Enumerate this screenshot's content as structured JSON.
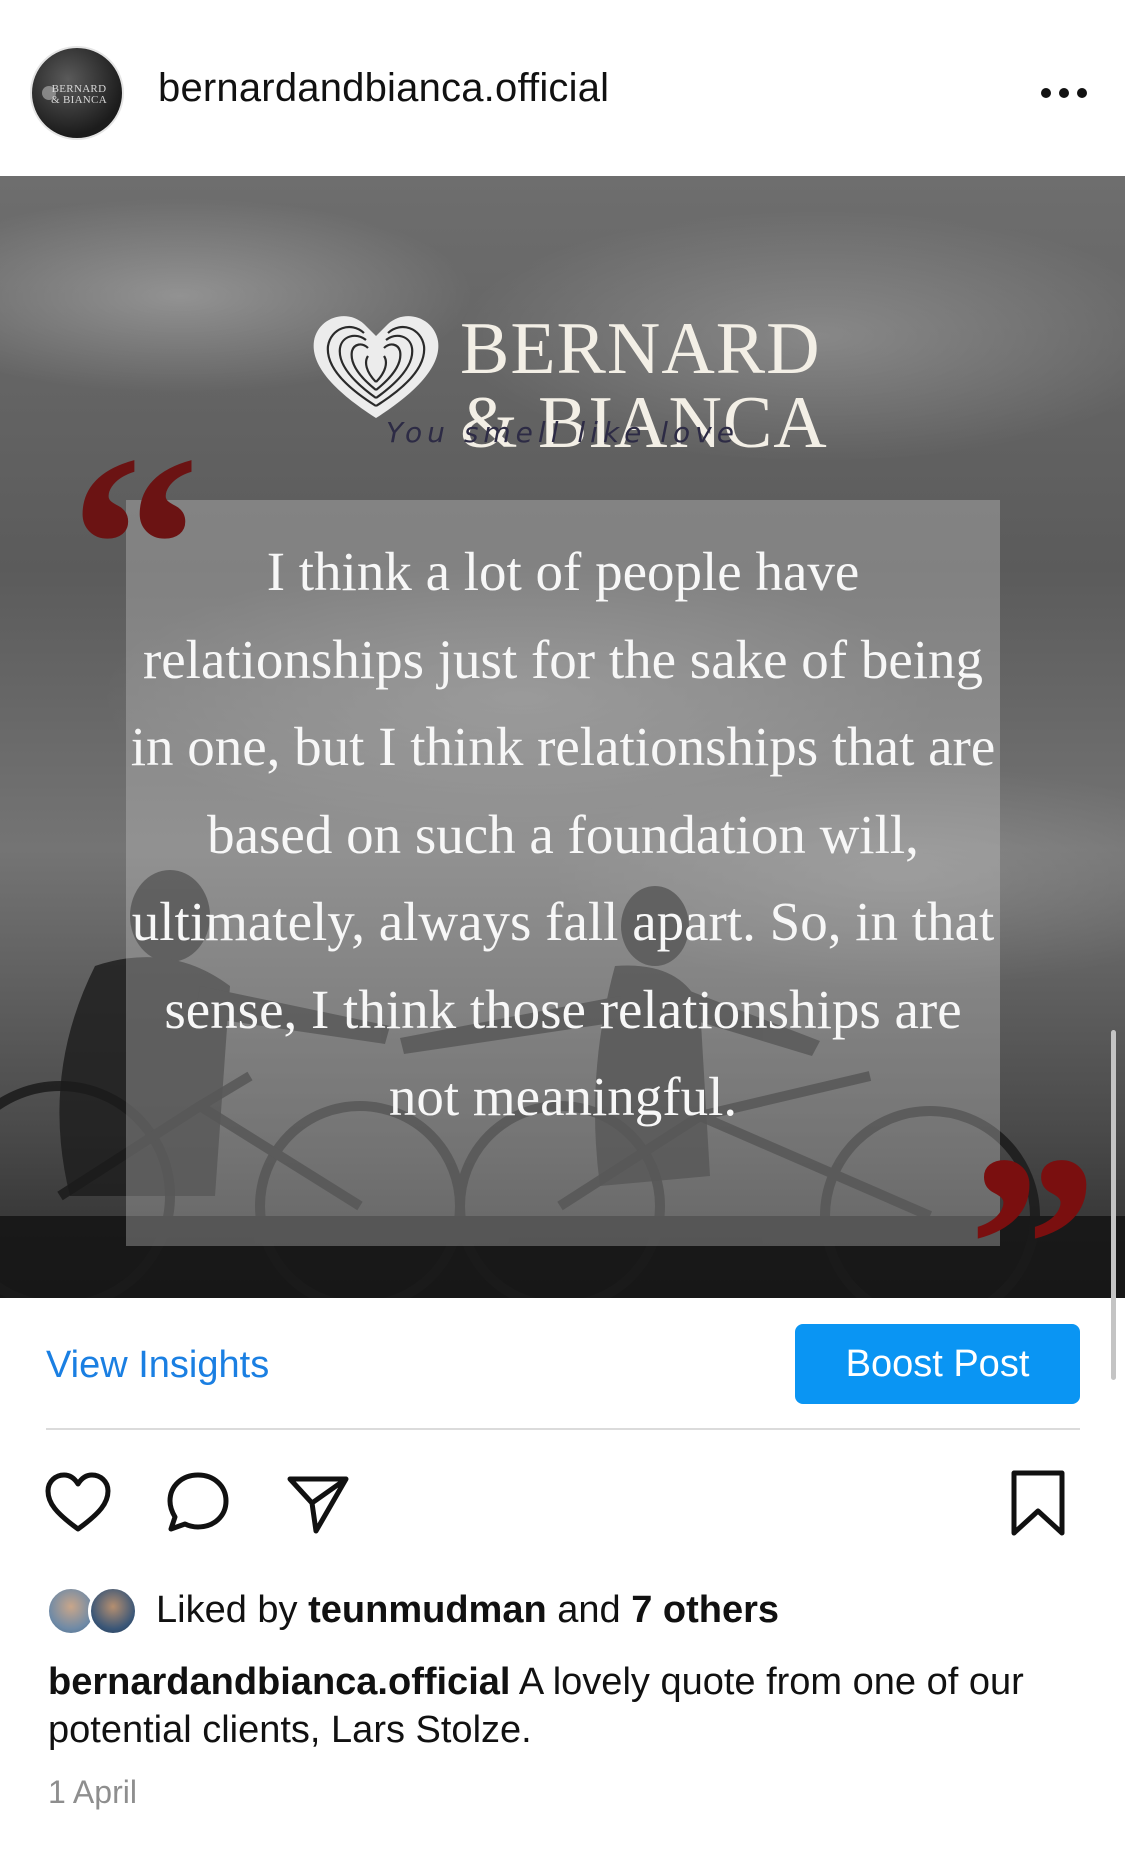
{
  "header": {
    "username": "bernardandbianca.official",
    "avatar_text": "BERNARD & BIANCA",
    "more_icon": "more-horizontal-icon"
  },
  "post_image": {
    "brand_line1": "BERNARD",
    "brand_line2": "& BIANCA",
    "tagline": "You smell like love",
    "quote": "I think a lot of people have relationships just for the sake of being in one, but I think relationships that are based on such a foundation will, ultimately, always fall apart. So, in that sense, I think those relationships are not meaningful.",
    "quote_open": "“",
    "quote_close": "”",
    "accent_color": "#6b1313"
  },
  "insights": {
    "view_label": "View Insights",
    "boost_label": "Boost Post",
    "link_color": "#1a7fe2",
    "button_color": "#0a95f3"
  },
  "actions": {
    "like_icon": "heart-icon",
    "comment_icon": "comment-icon",
    "share_icon": "send-icon",
    "save_icon": "bookmark-icon"
  },
  "likes": {
    "prefix": "Liked by",
    "user": "teunmudman",
    "middle": "and",
    "others": "7 others"
  },
  "caption": {
    "username": "bernardandbianca.official",
    "text": "A lovely quote from one of our potential clients, Lars Stolze."
  },
  "date": "1 April"
}
